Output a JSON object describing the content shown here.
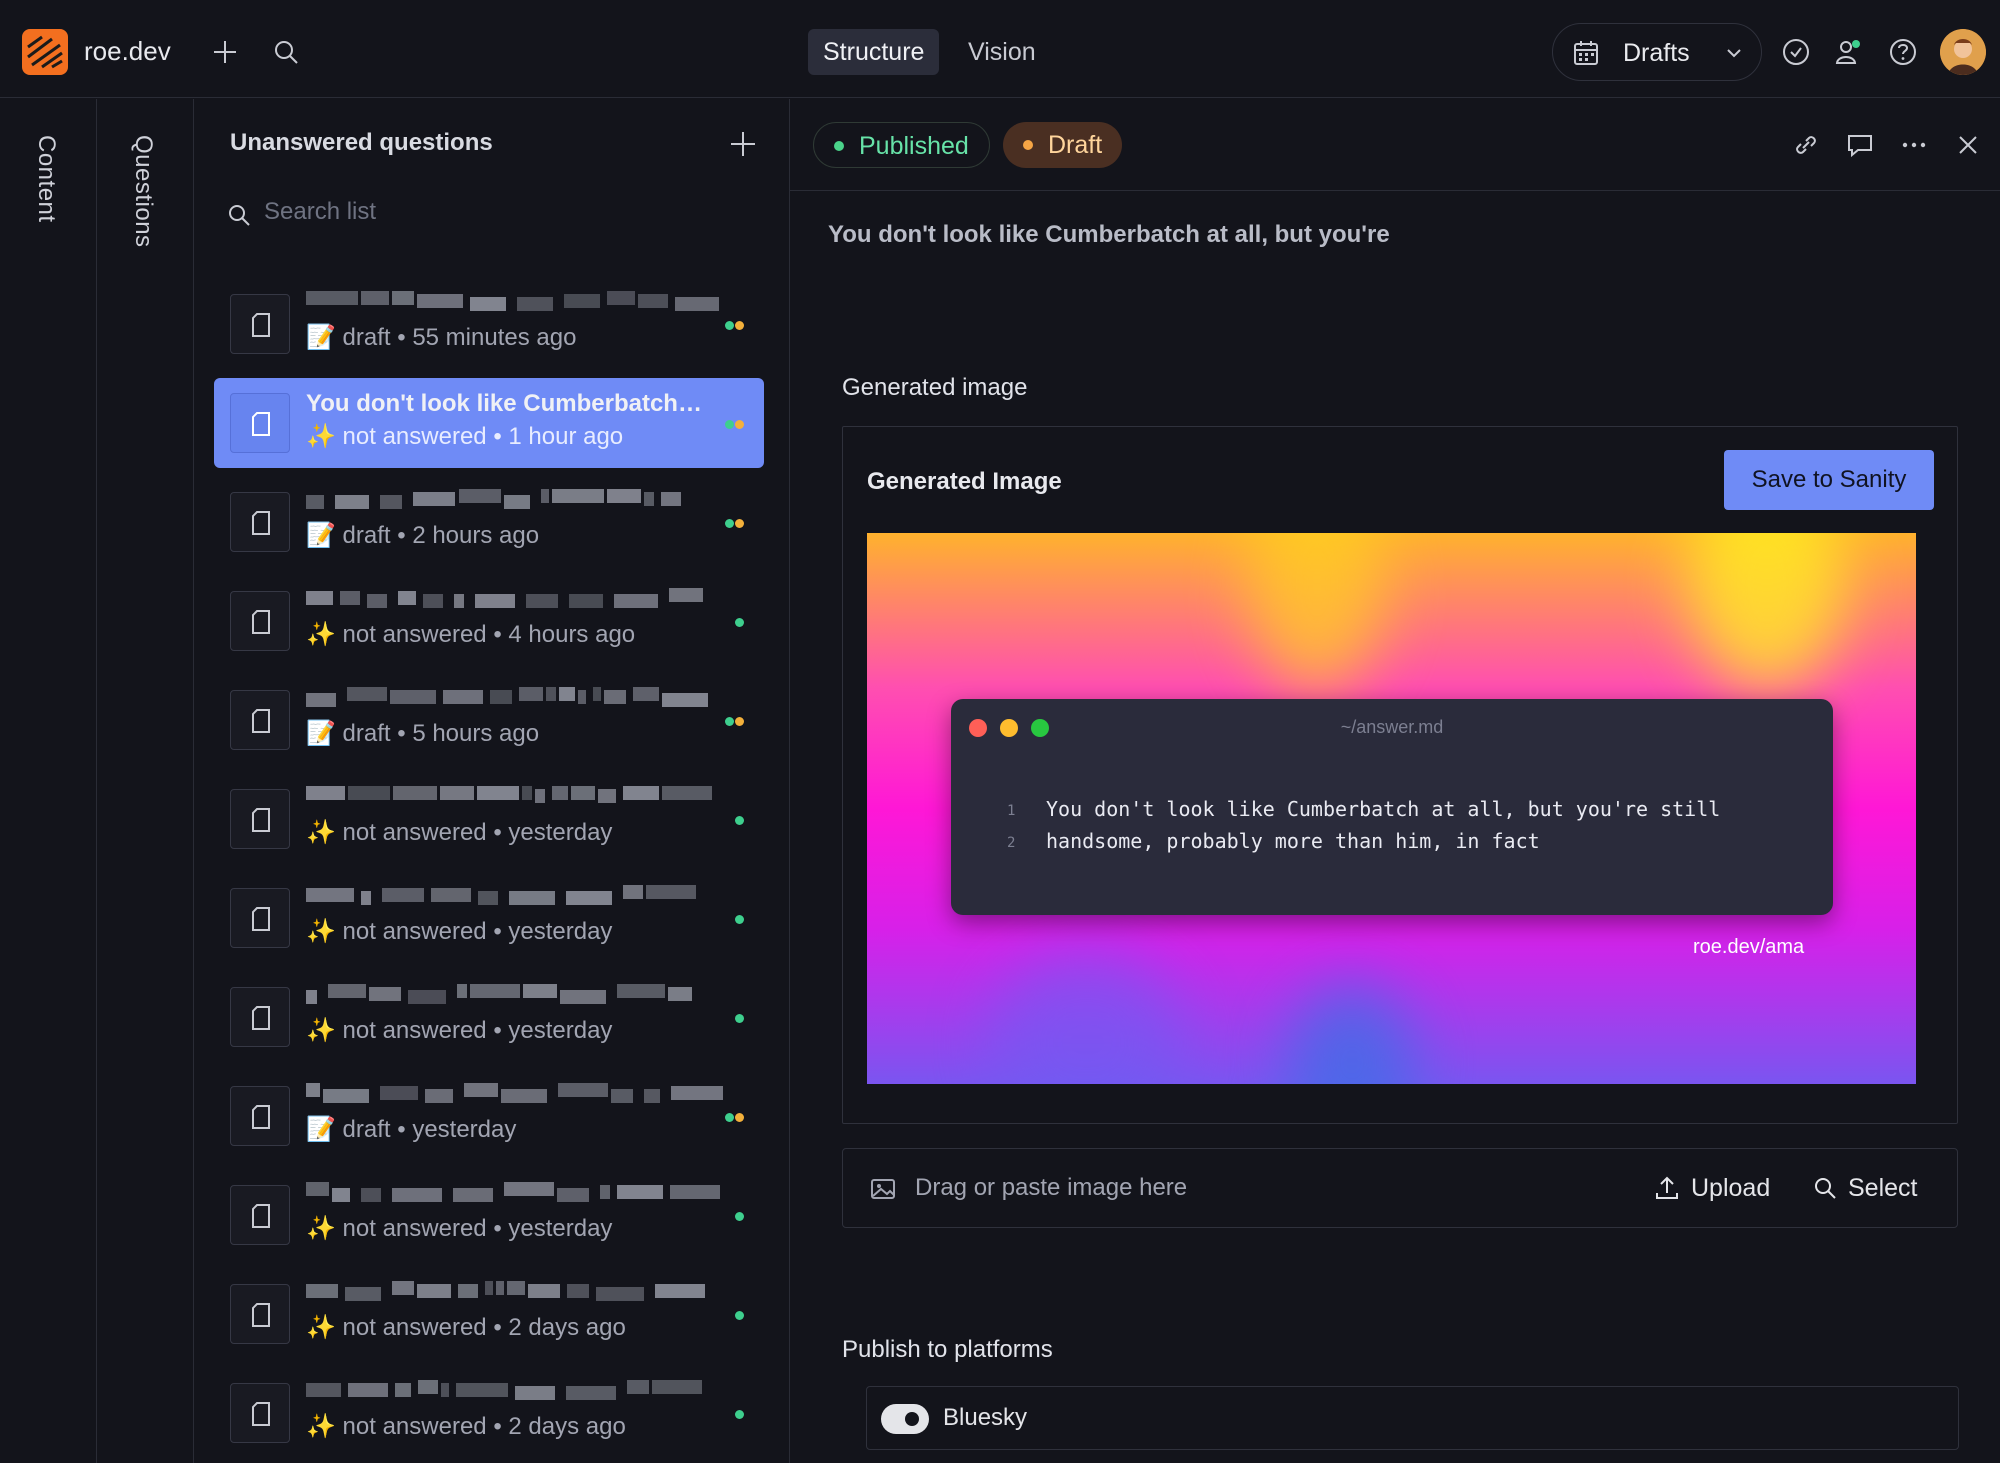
{
  "app": {
    "site_name": "roe.dev",
    "tabs": [
      "Structure",
      "Vision"
    ],
    "active_tab": "Structure",
    "release_menu": "Drafts"
  },
  "rails": {
    "content": "Content",
    "questions": "Questions"
  },
  "list": {
    "title": "Unanswered questions",
    "search_placeholder": "Search list",
    "items": [
      {
        "title": "",
        "status": "📝 draft • 55 minutes ago",
        "dots": [
          "#3ecf8e",
          "#f3b03b"
        ]
      },
      {
        "title": "You don't look like Cumberbatch at all, but you're still handsome, probably more than him, in fact",
        "status": "✨ not answered • 1 hour ago",
        "dots": [
          "#3ecf8e",
          "#f3b03b"
        ],
        "selected": true
      },
      {
        "title": "",
        "status": "📝 draft • 2 hours ago",
        "dots": [
          "#3ecf8e",
          "#f3b03b"
        ]
      },
      {
        "title": "",
        "status": "✨ not answered • 4 hours ago",
        "dots": [
          "#3ecf8e"
        ]
      },
      {
        "title": "",
        "status": "📝 draft • 5 hours ago",
        "dots": [
          "#3ecf8e",
          "#f3b03b"
        ]
      },
      {
        "title": "",
        "status": "✨ not answered • yesterday",
        "dots": [
          "#3ecf8e"
        ]
      },
      {
        "title": "",
        "status": "✨ not answered • yesterday",
        "dots": [
          "#3ecf8e"
        ]
      },
      {
        "title": "",
        "status": "✨ not answered • yesterday",
        "dots": [
          "#3ecf8e"
        ]
      },
      {
        "title": "",
        "status": "📝 draft • yesterday",
        "dots": [
          "#3ecf8e",
          "#f3b03b"
        ]
      },
      {
        "title": "",
        "status": "✨ not answered • yesterday",
        "dots": [
          "#3ecf8e"
        ]
      },
      {
        "title": "",
        "status": "✨ not answered • 2 days ago",
        "dots": [
          "#3ecf8e"
        ]
      },
      {
        "title": "",
        "status": "✨ not answered • 2 days ago",
        "dots": [
          "#3ecf8e"
        ]
      }
    ]
  },
  "document": {
    "status_published": "Published",
    "status_draft": "Draft",
    "title": "You don't look like Cumberbatch at all, but you're",
    "generated_image_label": "Generated image",
    "generated_image_title": "Generated Image",
    "save_button": "Save to Sanity",
    "terminal_filename": "~/answer.md",
    "code_lines": [
      {
        "n": "1",
        "text": "You don't look like Cumberbatch at all, but you're still"
      },
      {
        "n": "2",
        "text": "handsome, probably more than him, in fact"
      }
    ],
    "image_url_caption": "roe.dev/ama",
    "upload_placeholder": "Drag or paste image here",
    "upload_button": "Upload",
    "select_button": "Select",
    "publish_label": "Publish to platforms",
    "platforms": [
      {
        "name": "Bluesky",
        "enabled": true
      }
    ]
  },
  "colors": {
    "accent": "#6f8bf6",
    "published": "#3ecf8e",
    "draft": "#f3b03b",
    "brand": "#f36f1f"
  }
}
